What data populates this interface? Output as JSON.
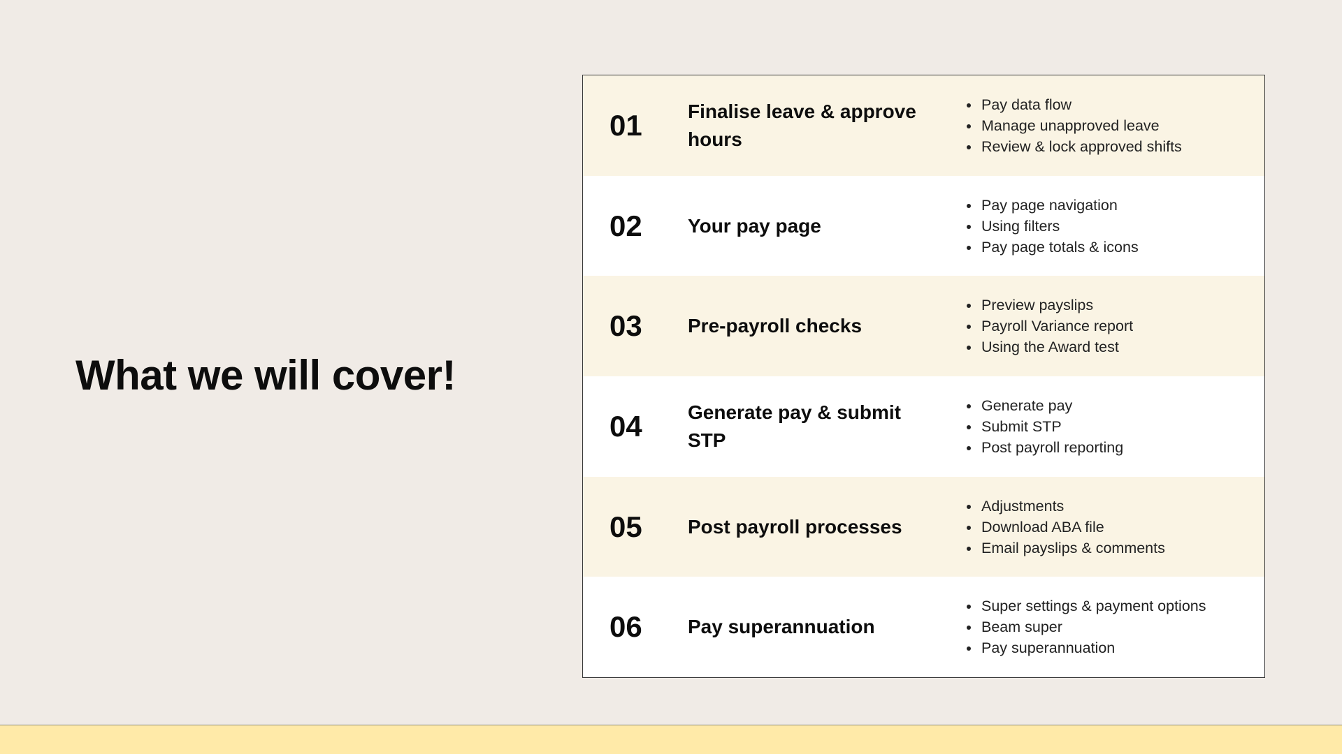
{
  "page": {
    "title": "What we will cover!"
  },
  "agenda": [
    {
      "number": "01",
      "title": "Finalise leave & approve hours",
      "bullets": [
        "Pay data flow",
        "Manage unapproved leave",
        "Review & lock approved shifts"
      ]
    },
    {
      "number": "02",
      "title": "Your pay page",
      "bullets": [
        "Pay page navigation",
        "Using filters",
        "Pay page totals & icons"
      ]
    },
    {
      "number": "03",
      "title": "Pre-payroll checks",
      "bullets": [
        "Preview payslips",
        "Payroll Variance report",
        "Using the Award test"
      ]
    },
    {
      "number": "04",
      "title": "Generate pay & submit STP",
      "bullets": [
        "Generate pay",
        "Submit STP",
        "Post payroll reporting"
      ]
    },
    {
      "number": "05",
      "title": "Post payroll processes",
      "bullets": [
        "Adjustments",
        "Download ABA file",
        "Email payslips & comments"
      ]
    },
    {
      "number": "06",
      "title": "Pay superannuation",
      "bullets": [
        "Super settings & payment options",
        "Beam super",
        "Pay superannuation"
      ]
    }
  ],
  "colors": {
    "background": "#f0ebe6",
    "row_alt": "#faf4e4",
    "row_plain": "#ffffff",
    "footer_band": "#ffeaa8"
  }
}
